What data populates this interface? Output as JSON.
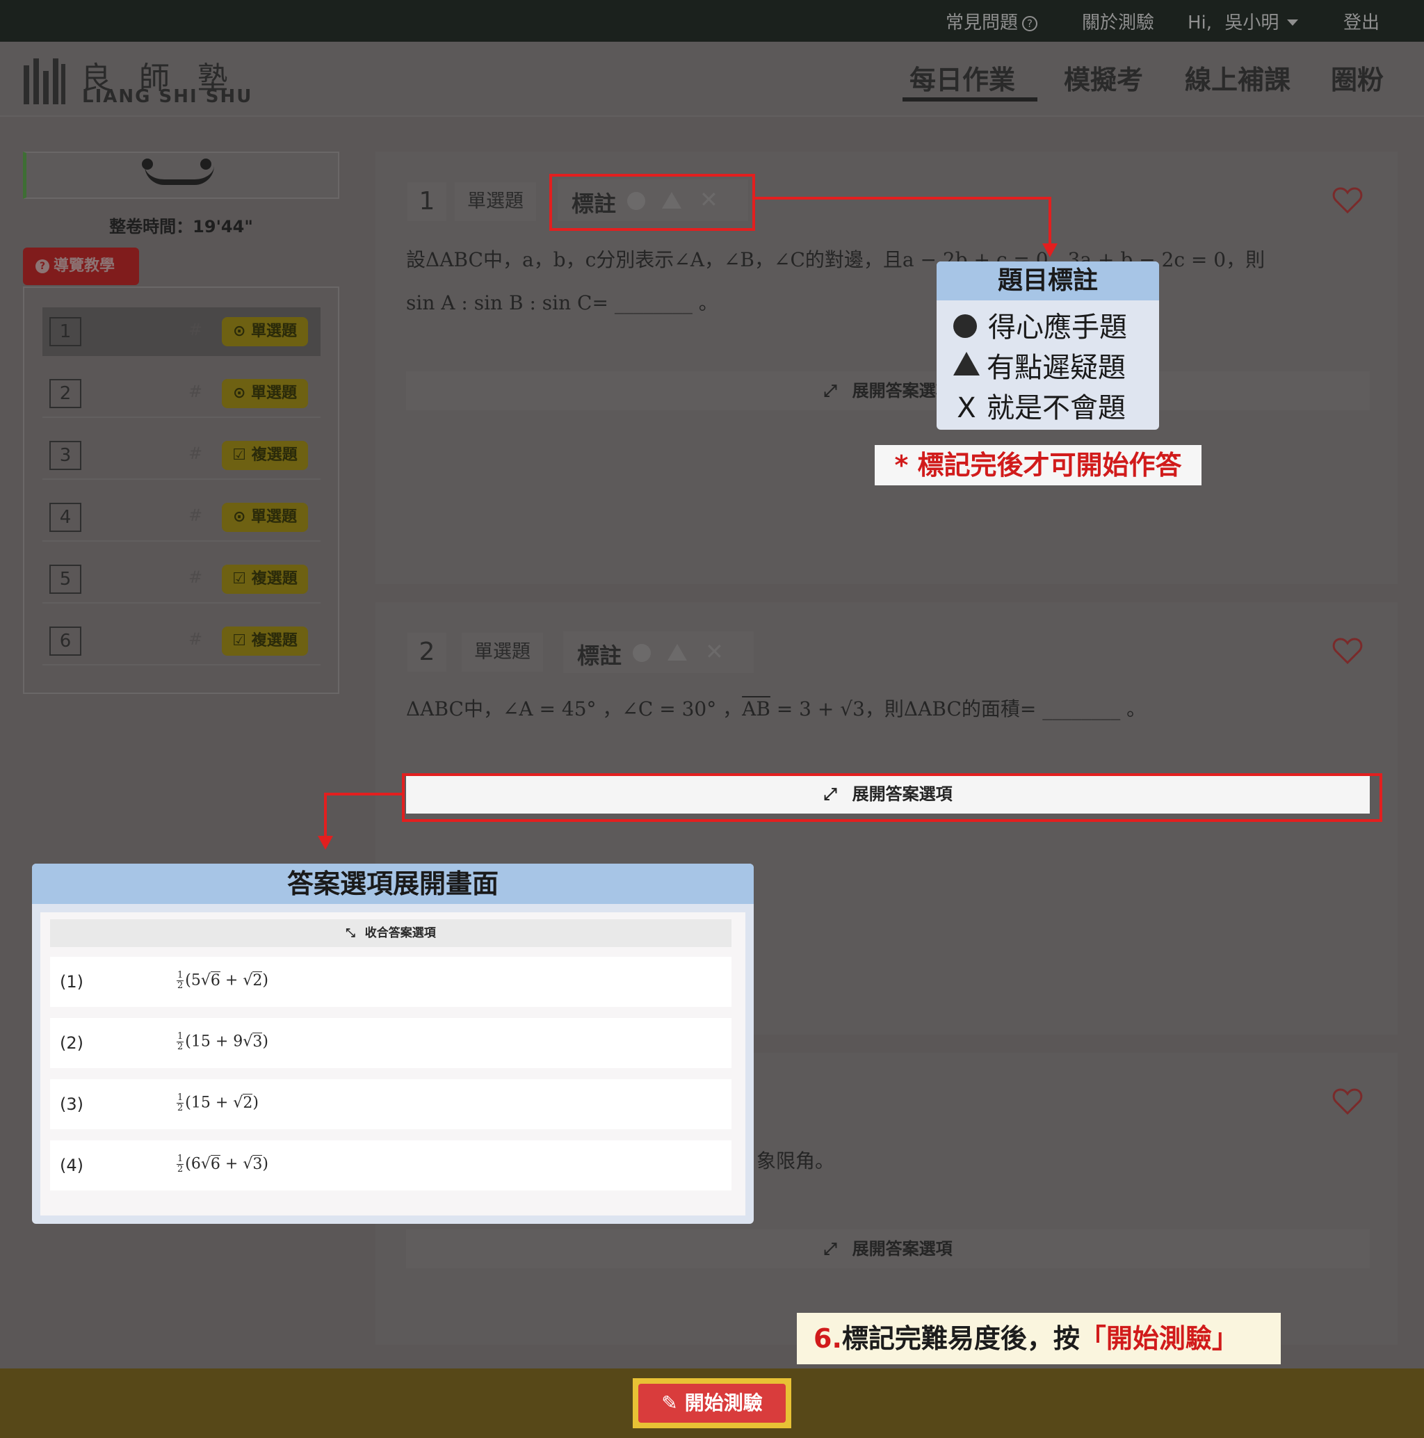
{
  "topbar": {
    "faq": "常見問題",
    "about": "關於測驗",
    "greeting": "Hi,",
    "user": "吳小明",
    "logout": "登出"
  },
  "logo": {
    "cn": "良師塾",
    "en": "LIANG SHI SHU"
  },
  "nav": {
    "items": [
      "每日作業",
      "模擬考",
      "線上補課",
      "圈粉"
    ],
    "active": "每日作業"
  },
  "sidebar": {
    "timer": "整卷時間：19'44\"",
    "guide": "導覽教學",
    "questions": [
      {
        "num": "1",
        "hash": "#",
        "type": "單選題",
        "icon": "circle-check-icon"
      },
      {
        "num": "2",
        "hash": "#",
        "type": "單選題",
        "icon": "circle-check-icon"
      },
      {
        "num": "3",
        "hash": "#",
        "type": "複選題",
        "icon": "square-check-icon"
      },
      {
        "num": "4",
        "hash": "#",
        "type": "單選題",
        "icon": "circle-check-icon"
      },
      {
        "num": "5",
        "hash": "#",
        "type": "複選題",
        "icon": "square-check-icon"
      },
      {
        "num": "6",
        "hash": "#",
        "type": "複選題",
        "icon": "square-check-icon"
      }
    ]
  },
  "questions": [
    {
      "num": "1",
      "type": "單選題",
      "mark_label": "標註",
      "line1": "設ΔABC中，a，b，c分別表示∠A，∠B，∠C的對邊，且a − 2b + c = 0，3a + b − 2c = 0，則",
      "line2": "sin A : sin B : sin C= ________ 。",
      "expand": "展開答案選項"
    },
    {
      "num": "2",
      "type": "單選題",
      "mark_label": "標註",
      "line1_a": "ΔABC中，∠A = 45° ，∠C = 30° ，",
      "line1_ab": "AB",
      "line1_b": " = 3 + √3，則ΔABC的面積= ________ 。",
      "expand": "展開答案選項"
    },
    {
      "text_fragment": "象限角。",
      "expand": "展開答案選項"
    }
  ],
  "legend": {
    "title": "題目標註",
    "items": [
      {
        "icon": "circle-icon",
        "label": "得心應手題"
      },
      {
        "icon": "triangle-icon",
        "label": "有點遲疑題"
      },
      {
        "icon": "x-icon",
        "symbol": "X",
        "label": "就是不會題"
      }
    ]
  },
  "note_mark_first": "* 標記完後才可開始作答",
  "answer_panel": {
    "title": "答案選項展開畫面",
    "collapse": "收合答案選項",
    "options": [
      {
        "num": "(1)",
        "frac_num": "1",
        "frac_den": "2",
        "pre": "(5",
        "rad1": "6",
        "mid": " + ",
        "rad2": "2",
        "post": ")"
      },
      {
        "num": "(2)",
        "frac_num": "1",
        "frac_den": "2",
        "pre": "(15 + 9",
        "rad1": "3",
        "mid": "",
        "rad2": "",
        "post": ")"
      },
      {
        "num": "(3)",
        "frac_num": "1",
        "frac_den": "2",
        "pre": "(15 + ",
        "rad1": "2",
        "mid": "",
        "rad2": "",
        "post": ")"
      },
      {
        "num": "(4)",
        "frac_num": "1",
        "frac_den": "2",
        "pre": "(6",
        "rad1": "6",
        "mid": " + ",
        "rad2": "3",
        "post": ")"
      }
    ]
  },
  "step_note": {
    "num": "6.",
    "text": "標記完難易度後，按",
    "highlight": "「開始測驗」"
  },
  "start_button": "開始測驗",
  "colors": {
    "annotation_red": "#e21f1f",
    "legend_blue": "#a7c5e6",
    "start_red": "#d93c3c",
    "start_border": "#e8c235"
  }
}
